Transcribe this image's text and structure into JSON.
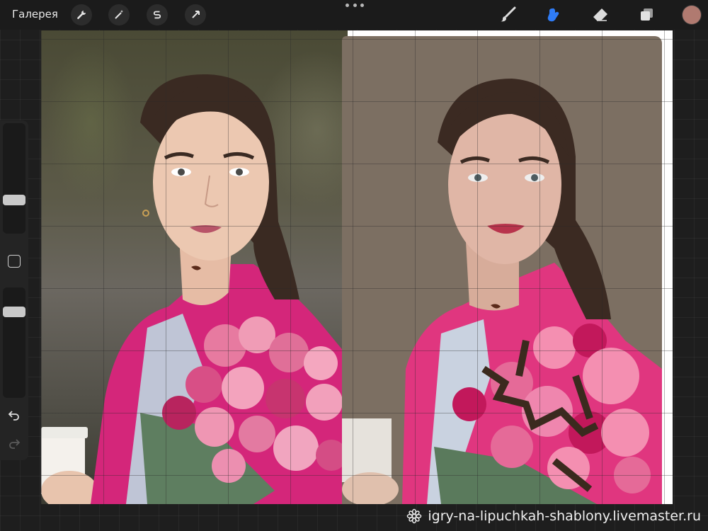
{
  "topbar": {
    "gallery_label": "Галерея",
    "tools_left": [
      "wrench-icon",
      "magic-wand-icon",
      "selection-s-icon",
      "transform-arrow-icon"
    ],
    "tools_right": [
      "brush-icon",
      "smudge-icon",
      "eraser-icon",
      "layers-icon"
    ],
    "active_tool": "smudge-icon",
    "accent_color": "#2f7cf6",
    "current_color": "#b07a70"
  },
  "sidebar": {
    "brush_size_level": 0.62,
    "opacity_level": 0.8,
    "controls": [
      "modify-button",
      "undo-icon",
      "redo-icon"
    ]
  },
  "canvas": {
    "background_color": "#ffffff",
    "painting_bg": "#7c6f62",
    "palette": [
      "#e0367f",
      "#c2185b",
      "#f48fb1",
      "#5a7a5c",
      "#3b2a1e",
      "#d9b1a3"
    ]
  },
  "watermark": {
    "text": "igry-na-lipuchkah-shablony.livemaster.ru",
    "icon": "flower-icon"
  }
}
